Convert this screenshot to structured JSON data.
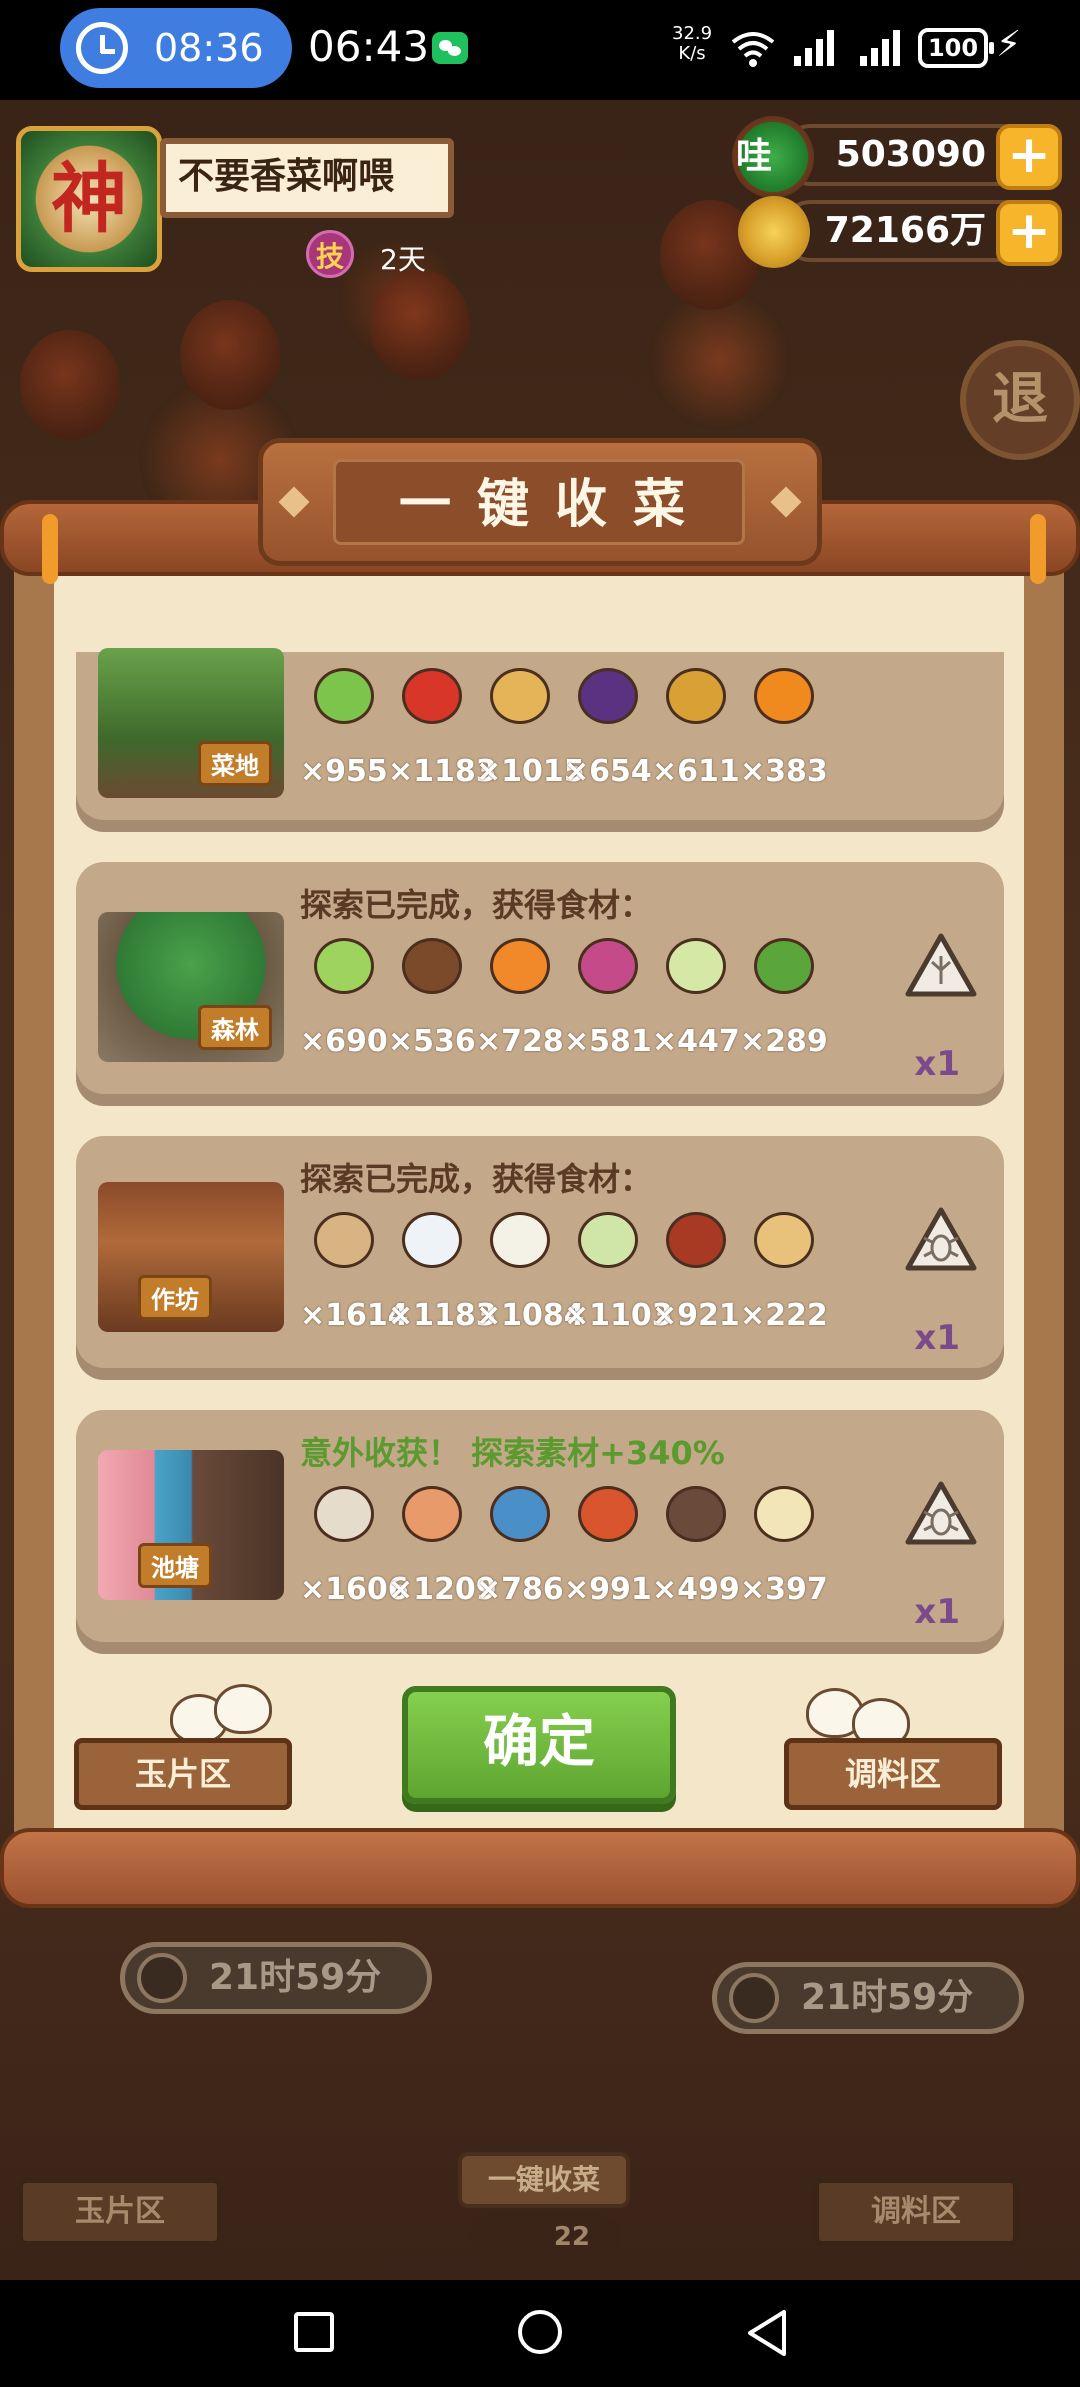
{
  "status_bar": {
    "alarm_time": "08:36",
    "time": "06:43",
    "net_speed_value": "32.9",
    "net_speed_unit": "K/s",
    "battery": "100",
    "icons": [
      "alarm-clock-icon",
      "wechat-icon",
      "wifi-icon",
      "signal-icon",
      "battery-icon",
      "charging-bolt-icon"
    ]
  },
  "player": {
    "avatar_glyph": "神",
    "name": "不要香菜啊喂",
    "skill_badge": "技",
    "skill_days": "2天"
  },
  "currencies": [
    {
      "name": "jade",
      "icon_text": "哇",
      "value": "503090",
      "plus": "+"
    },
    {
      "name": "coins",
      "value": "72166万",
      "plus": "+"
    }
  ],
  "background": {
    "exit_label": "退",
    "timer_left": "21时59分",
    "timer_right": "21时59分",
    "left_btn": "玉片区",
    "right_btn": "调料区",
    "harvest_btn": "一键收菜",
    "harvest_count": "22"
  },
  "dialog": {
    "title": "一键收菜",
    "confirm": "确定",
    "left_btn": "玉片区",
    "right_btn": "调料区",
    "cards": [
      {
        "location": "菜地",
        "status": "",
        "foods": [
          {
            "icon": "scallion-icon",
            "color": "#7cc44b",
            "qty": "×955"
          },
          {
            "icon": "chili-pepper-icon",
            "color": "#d9362a",
            "qty": "×1183"
          },
          {
            "icon": "potato-icon",
            "color": "#e6b458",
            "qty": "×1015"
          },
          {
            "icon": "eggplant-icon",
            "color": "#5b3182",
            "qty": "×654"
          },
          {
            "icon": "pineapple-basket-icon",
            "color": "#d9a036",
            "qty": "×611"
          },
          {
            "icon": "pumpkin-icon",
            "color": "#f08a1e",
            "qty": "×383"
          }
        ],
        "token_count": ""
      },
      {
        "location": "森林",
        "status": "探索已完成，获得食材：",
        "foods": [
          {
            "icon": "cabbage-icon",
            "color": "#9ed35e",
            "qty": "×690"
          },
          {
            "icon": "mushroom-icon",
            "color": "#7a4a2a",
            "qty": "×536"
          },
          {
            "icon": "carrot-icon",
            "color": "#f1892a",
            "qty": "×728"
          },
          {
            "icon": "turnip-icon",
            "color": "#c44a8a",
            "qty": "×581"
          },
          {
            "icon": "bamboo-shoot-icon",
            "color": "#d6e8a6",
            "qty": "×447"
          },
          {
            "icon": "herb-icon",
            "color": "#5aa63a",
            "qty": "×289"
          }
        ],
        "token_count": "x1"
      },
      {
        "location": "作坊",
        "status": "探索已完成，获得食材：",
        "foods": [
          {
            "icon": "flour-sack-icon",
            "color": "#d8b482",
            "qty": "×1614"
          },
          {
            "icon": "rice-bowl-icon",
            "color": "#eef3f8",
            "qty": "×1183"
          },
          {
            "icon": "tofu-icon",
            "color": "#f4f1e6",
            "qty": "×1084"
          },
          {
            "icon": "sticky-rice-icon",
            "color": "#cfe6a8",
            "qty": "×1103"
          },
          {
            "icon": "sauce-jar-icon",
            "color": "#a83a24",
            "qty": "×921"
          },
          {
            "icon": "gravy-boat-icon",
            "color": "#e8c27a",
            "qty": "×222"
          }
        ],
        "token_count": "x1"
      },
      {
        "location": "池塘",
        "status": "意外收获！ 探索素材+340%",
        "foods": [
          {
            "icon": "clam-icon",
            "color": "#e6dccb",
            "qty": "×1606"
          },
          {
            "icon": "shrimp-icon",
            "color": "#e89a6a",
            "qty": "×1209"
          },
          {
            "icon": "fish-icon",
            "color": "#4a8fc8",
            "qty": "×786"
          },
          {
            "icon": "meat-icon",
            "color": "#d8552e",
            "qty": "×991"
          },
          {
            "icon": "crab-icon",
            "color": "#6a4a3a",
            "qty": "×499"
          },
          {
            "icon": "fin-icon",
            "color": "#f2e6b8",
            "qty": "×397"
          }
        ],
        "token_count": "x1"
      }
    ]
  }
}
